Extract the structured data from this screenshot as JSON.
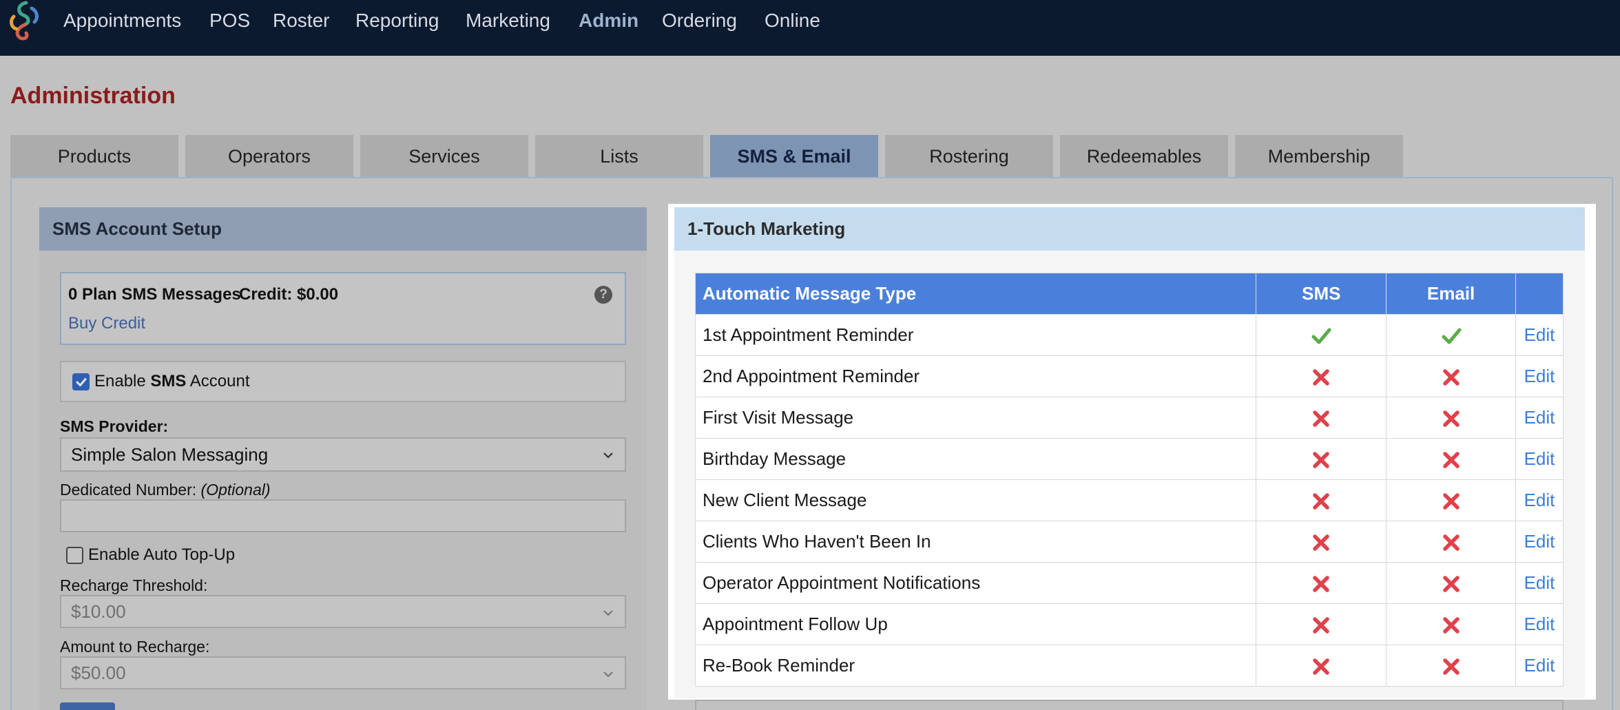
{
  "nav": {
    "items": [
      {
        "label": "Appointments",
        "active": false
      },
      {
        "label": "POS",
        "active": false
      },
      {
        "label": "Roster",
        "active": false
      },
      {
        "label": "Reporting",
        "active": false
      },
      {
        "label": "Marketing",
        "active": false
      },
      {
        "label": "Admin",
        "active": true
      },
      {
        "label": "Ordering",
        "active": false
      },
      {
        "label": "Online",
        "active": false
      }
    ]
  },
  "page": {
    "title": "Administration"
  },
  "tabs": [
    {
      "label": "Products",
      "active": false
    },
    {
      "label": "Operators",
      "active": false
    },
    {
      "label": "Services",
      "active": false
    },
    {
      "label": "Lists",
      "active": false
    },
    {
      "label": "SMS & Email",
      "active": true
    },
    {
      "label": "Rostering",
      "active": false
    },
    {
      "label": "Redeemables",
      "active": false
    },
    {
      "label": "Membership",
      "active": false
    }
  ],
  "sms_setup": {
    "header": "SMS Account Setup",
    "plan_messages": "0 Plan SMS Messages",
    "credit": "Credit: $0.00",
    "buy_credit": "Buy Credit",
    "help_icon": "?",
    "enable_sms": {
      "prefix": "Enable ",
      "bold": "SMS",
      "suffix": " Account",
      "checked": true
    },
    "provider_label": "SMS Provider:",
    "provider_value": "Simple Salon Messaging",
    "dedicated_label": "Dedicated Number:",
    "dedicated_optional": "(Optional)",
    "dedicated_value": "",
    "auto_topup": {
      "label": "Enable Auto Top-Up",
      "checked": false
    },
    "threshold_label": "Recharge Threshold:",
    "threshold_value": "$10.00",
    "recharge_label": "Amount to Recharge:",
    "recharge_value": "$50.00"
  },
  "marketing": {
    "header": "1-Touch Marketing",
    "columns": {
      "type": "Automatic Message Type",
      "sms": "SMS",
      "email": "Email",
      "action": ""
    },
    "rows": [
      {
        "type": "1st Appointment Reminder",
        "sms": true,
        "email": true,
        "action": "Edit"
      },
      {
        "type": "2nd Appointment Reminder",
        "sms": false,
        "email": false,
        "action": "Edit"
      },
      {
        "type": "First Visit Message",
        "sms": false,
        "email": false,
        "action": "Edit"
      },
      {
        "type": "Birthday Message",
        "sms": false,
        "email": false,
        "action": "Edit"
      },
      {
        "type": "New Client Message",
        "sms": false,
        "email": false,
        "action": "Edit"
      },
      {
        "type": "Clients Who Haven't Been In",
        "sms": false,
        "email": false,
        "action": "Edit"
      },
      {
        "type": "Operator Appointment Notifications",
        "sms": false,
        "email": false,
        "action": "Edit"
      },
      {
        "type": "Appointment Follow Up",
        "sms": false,
        "email": false,
        "action": "Edit"
      },
      {
        "type": "Re-Book Reminder",
        "sms": false,
        "email": false,
        "action": "Edit"
      }
    ]
  },
  "colors": {
    "nav_bg": "#0c1a30",
    "title_red": "#8b1b1b",
    "table_header": "#4a80dc",
    "check_green": "#5cab4a",
    "cross_red": "#e0414a",
    "link_blue": "#3b7ed8"
  }
}
